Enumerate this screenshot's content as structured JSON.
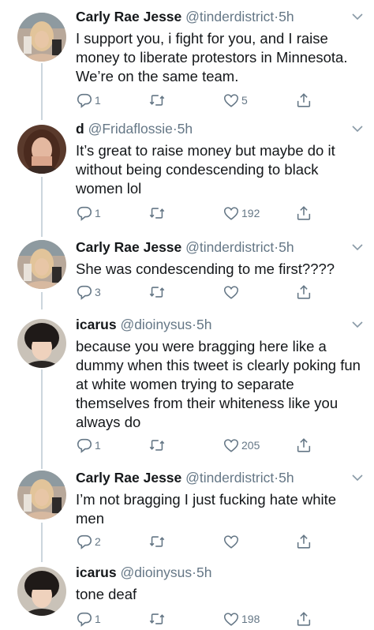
{
  "colors": {
    "text": "#14171a",
    "secondary": "#657786",
    "thread_line": "#ccd6dd"
  },
  "tweets": [
    {
      "name": "Carly Rae Jesse",
      "handle": "@tinderdistrict",
      "separator": "·",
      "time": "5h",
      "text": "I support you, i fight for you, and I raise money to liberate protestors in Minnesota. We’re on the same team.",
      "replies": "1",
      "retweets": "",
      "likes": "5",
      "avatar_icon": "profile-photo-blonde"
    },
    {
      "name": "d",
      "handle": "@Fridaflossie",
      "separator": "·",
      "time": "5h",
      "text": "It’s great to raise money but maybe do it without being condescending to black women lol",
      "replies": "1",
      "retweets": "",
      "likes": "192",
      "avatar_icon": "profile-photo-brunette"
    },
    {
      "name": "Carly Rae Jesse",
      "handle": "@tinderdistrict",
      "separator": "·",
      "time": "5h",
      "text": "She was condescending to me first????",
      "replies": "3",
      "retweets": "",
      "likes": "",
      "avatar_icon": "profile-photo-blonde"
    },
    {
      "name": "icarus",
      "handle": "@dioinysus",
      "separator": "·",
      "time": "5h",
      "text": "because you were bragging here like a dummy when this tweet is clearly poking fun at white women trying to separate themselves from their whiteness like you always do",
      "replies": "1",
      "retweets": "",
      "likes": "205",
      "avatar_icon": "profile-photo-dark-hair"
    },
    {
      "name": "Carly Rae Jesse",
      "handle": "@tinderdistrict",
      "separator": "·",
      "time": "5h",
      "text": "I’m not bragging I just fucking hate white men",
      "replies": "2",
      "retweets": "",
      "likes": "",
      "avatar_icon": "profile-photo-blonde"
    },
    {
      "name": "icarus",
      "handle": "@dioinysus",
      "separator": "·",
      "time": "5h",
      "text": "tone deaf",
      "replies": "1",
      "retweets": "",
      "likes": "198",
      "avatar_icon": "profile-photo-dark-hair"
    }
  ]
}
